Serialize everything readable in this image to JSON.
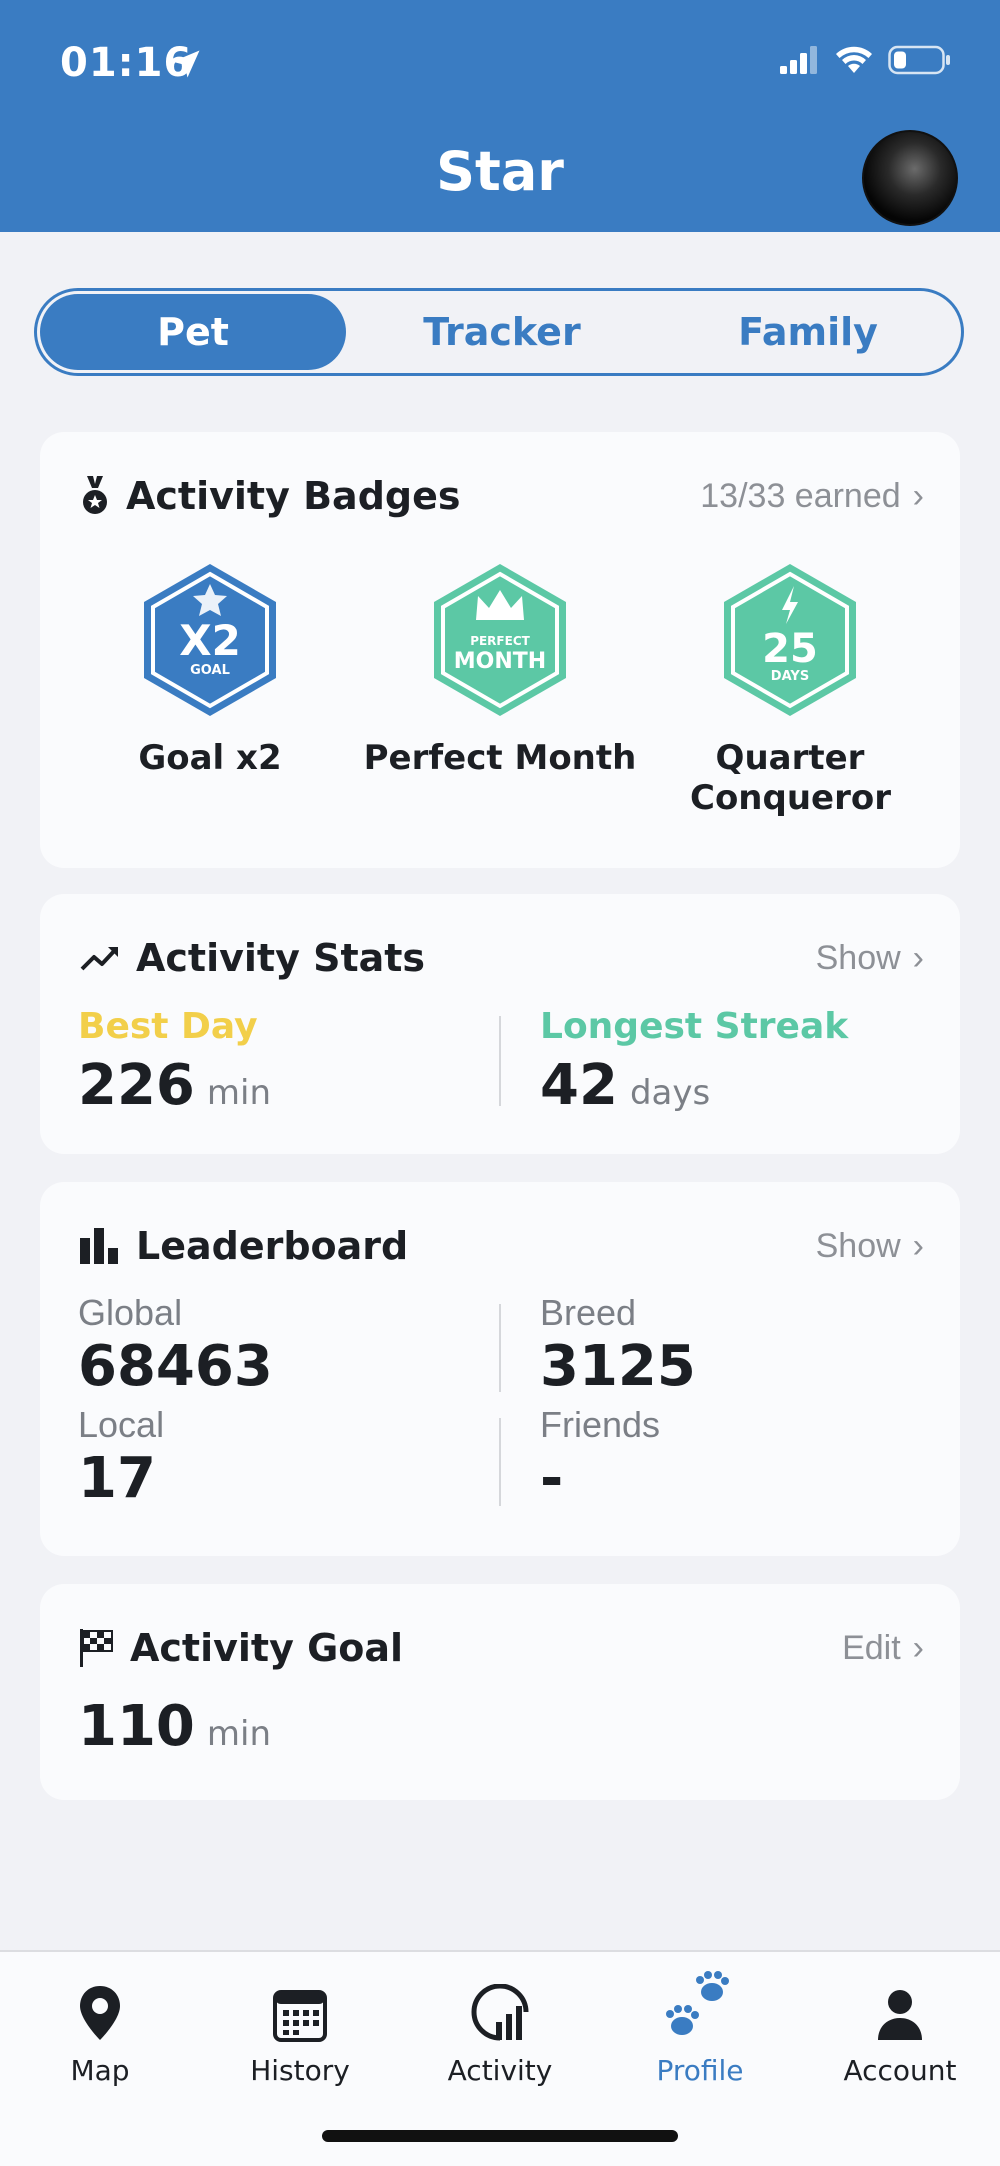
{
  "status_bar": {
    "time": "01:16"
  },
  "header": {
    "title": "Star"
  },
  "segments": [
    {
      "label": "Pet",
      "active": true
    },
    {
      "label": "Tracker",
      "active": false
    },
    {
      "label": "Family",
      "active": false
    }
  ],
  "badges_card": {
    "title": "Activity Badges",
    "icon": "medal-icon",
    "action": "13/33 earned",
    "badges": [
      {
        "label": "Goal x2",
        "main_text": "X2",
        "sub_text": "GOAL",
        "color": "#3a7cc2",
        "icon": "star-icon"
      },
      {
        "label": "Perfect Month",
        "main_text": "MONTH",
        "sub_text": "PERFECT",
        "color": "#5cc8a5",
        "icon": "crown-icon"
      },
      {
        "label": "Quarter Conqueror",
        "main_text": "25",
        "sub_text": "DAYS",
        "color": "#5cc8a5",
        "icon": "bolt-icon"
      }
    ]
  },
  "stats_card": {
    "title": "Activity Stats",
    "icon": "trend-up-icon",
    "action": "Show",
    "best_day": {
      "label": "Best Day",
      "value": "226",
      "unit": "min",
      "color": "#f2cf4a"
    },
    "longest_streak": {
      "label": "Longest Streak",
      "value": "42",
      "unit": "days",
      "color": "#5cc8a5"
    }
  },
  "leaderboard_card": {
    "title": "Leaderboard",
    "icon": "bar-chart-icon",
    "action": "Show",
    "global": {
      "label": "Global",
      "value": "68463"
    },
    "breed": {
      "label": "Breed",
      "value": "3125"
    },
    "local": {
      "label": "Local",
      "value": "17"
    },
    "friends": {
      "label": "Friends",
      "value": "-"
    }
  },
  "goal_card": {
    "title": "Activity Goal",
    "icon": "checkered-flag-icon",
    "action": "Edit",
    "value": "110",
    "unit": "min"
  },
  "tabbar": {
    "tabs": [
      {
        "label": "Map",
        "icon": "map-pin-icon",
        "active": false
      },
      {
        "label": "History",
        "icon": "calendar-icon",
        "active": false
      },
      {
        "label": "Activity",
        "icon": "activity-gauge-icon",
        "active": false
      },
      {
        "label": "Profile",
        "icon": "paw-icon",
        "active": true
      },
      {
        "label": "Account",
        "icon": "person-icon",
        "active": false
      }
    ]
  },
  "colors": {
    "primary": "#3a7cc2",
    "teal": "#5cc8a5",
    "yellow": "#f2cf4a"
  }
}
